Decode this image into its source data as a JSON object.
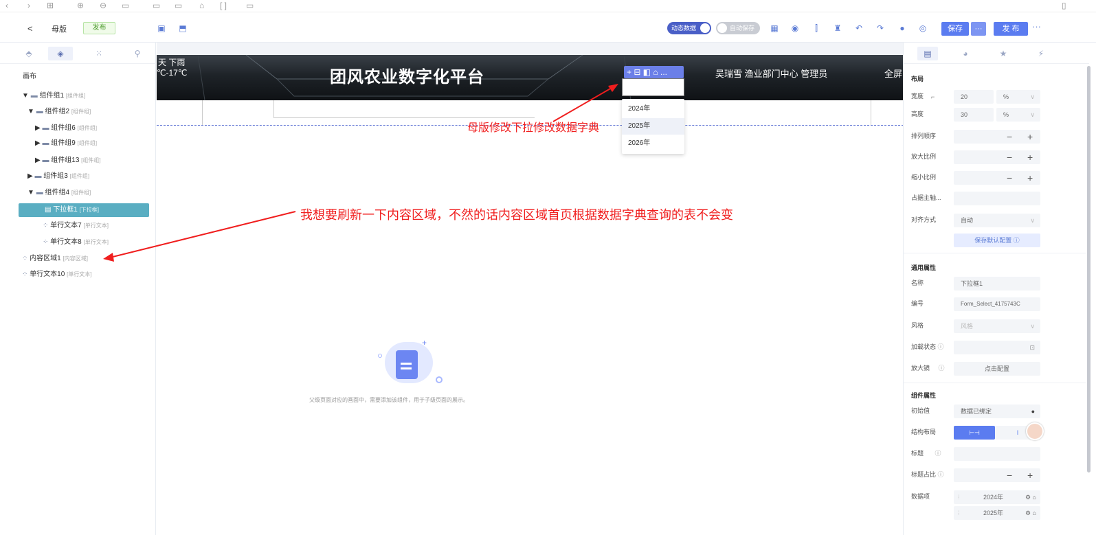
{
  "window_bar": {
    "icons": [
      "back-icon",
      "forward-icon",
      "grid-icon",
      "zoom-in-icon",
      "zoom-out-icon",
      "screen-icon",
      "frame-icon",
      "frame2-icon",
      "lock-icon",
      "bracket-icon",
      "doc-icon"
    ]
  },
  "toolbar": {
    "back_label": "<",
    "title": "母版",
    "badge": "发布",
    "dynamic_data_label": "动态数据",
    "autosave_label": "自动保存",
    "save_label": "保存",
    "more_label": "···",
    "publish_label": "发 布",
    "overflow_label": "···"
  },
  "left_panel": {
    "root": "画布",
    "tree": [
      {
        "label": "组件组1",
        "sub": "[组件组]",
        "arrow": "▼"
      },
      {
        "label": "组件组2",
        "sub": "[组件组]",
        "arrow": "▼"
      },
      {
        "label": "组件组6",
        "sub": "[组件组]",
        "arrow": "▶"
      },
      {
        "label": "组件组9",
        "sub": "[组件组]",
        "arrow": "▶"
      },
      {
        "label": "组件组13",
        "sub": "[组件组]",
        "arrow": "▶"
      },
      {
        "label": "组件组3",
        "sub": "[组件组]",
        "arrow": "▶"
      },
      {
        "label": "组件组4",
        "sub": "[组件组]",
        "arrow": "▼"
      },
      {
        "label": "下拉框1",
        "sub": "[下拉框]",
        "arrow": ""
      },
      {
        "label": "单行文本7",
        "sub": "[单行文本]",
        "arrow": ""
      },
      {
        "label": "单行文本8",
        "sub": "[单行文本]",
        "arrow": ""
      },
      {
        "label": "内容区域1",
        "sub": "[内容区域]",
        "arrow": ""
      },
      {
        "label": "单行文本10",
        "sub": "[单行文本]",
        "arrow": ""
      }
    ]
  },
  "canvas": {
    "weather_line1": "天 下雨",
    "weather_line2": "℃-17℃",
    "platform_title": "团风农业数字化平台",
    "user_info": "吴瑞雪 渔业部门中心 管理员",
    "fullscreen": "全屏",
    "select_toolbar": "+ ⊟ ◧ ⌂ ...",
    "select_value": "2025年",
    "select_options": [
      "2024年",
      "2025年",
      "2026年"
    ],
    "empty_hint": "父级页面对应的画面中，需要添加该组件，用于子级页面的展示。"
  },
  "annotations": {
    "note1": "母版修改下拉修改数据字典",
    "note2": "我想要刷新一下内容区域，不然的话内容区域首页根据数据字典查询的表不会变"
  },
  "right_panel": {
    "layout_header": "布局",
    "width_label": "宽度",
    "width_value": "20",
    "width_unit": "%",
    "height_label": "高度",
    "height_value": "30",
    "height_unit": "%",
    "order_label": "排列顺序",
    "grow_label": "放大比例",
    "shrink_label": "缩小比例",
    "basis_label": "占据主轴...",
    "align_label": "对齐方式",
    "align_value": "自动",
    "save_default": "保存默认配置 ⓘ",
    "general_header": "通用属性",
    "name_label": "名称",
    "name_value": "下拉框1",
    "id_label": "编号",
    "id_value": "Form_Select_4175743C",
    "style_label": "风格",
    "style_value": "风格",
    "loading_label": "加载状态",
    "magnifier_label": "放大镜",
    "magnifier_value": "点击配置",
    "component_header": "组件属性",
    "initial_label": "初始值",
    "initial_value": "数据已绑定",
    "structure_label": "结构布局",
    "title_label": "标题",
    "title_ratio_label": "标题占比",
    "data_items_label": "数据项",
    "data_items": [
      "2024年",
      "2025年"
    ],
    "minus": "−",
    "plus": "+"
  }
}
